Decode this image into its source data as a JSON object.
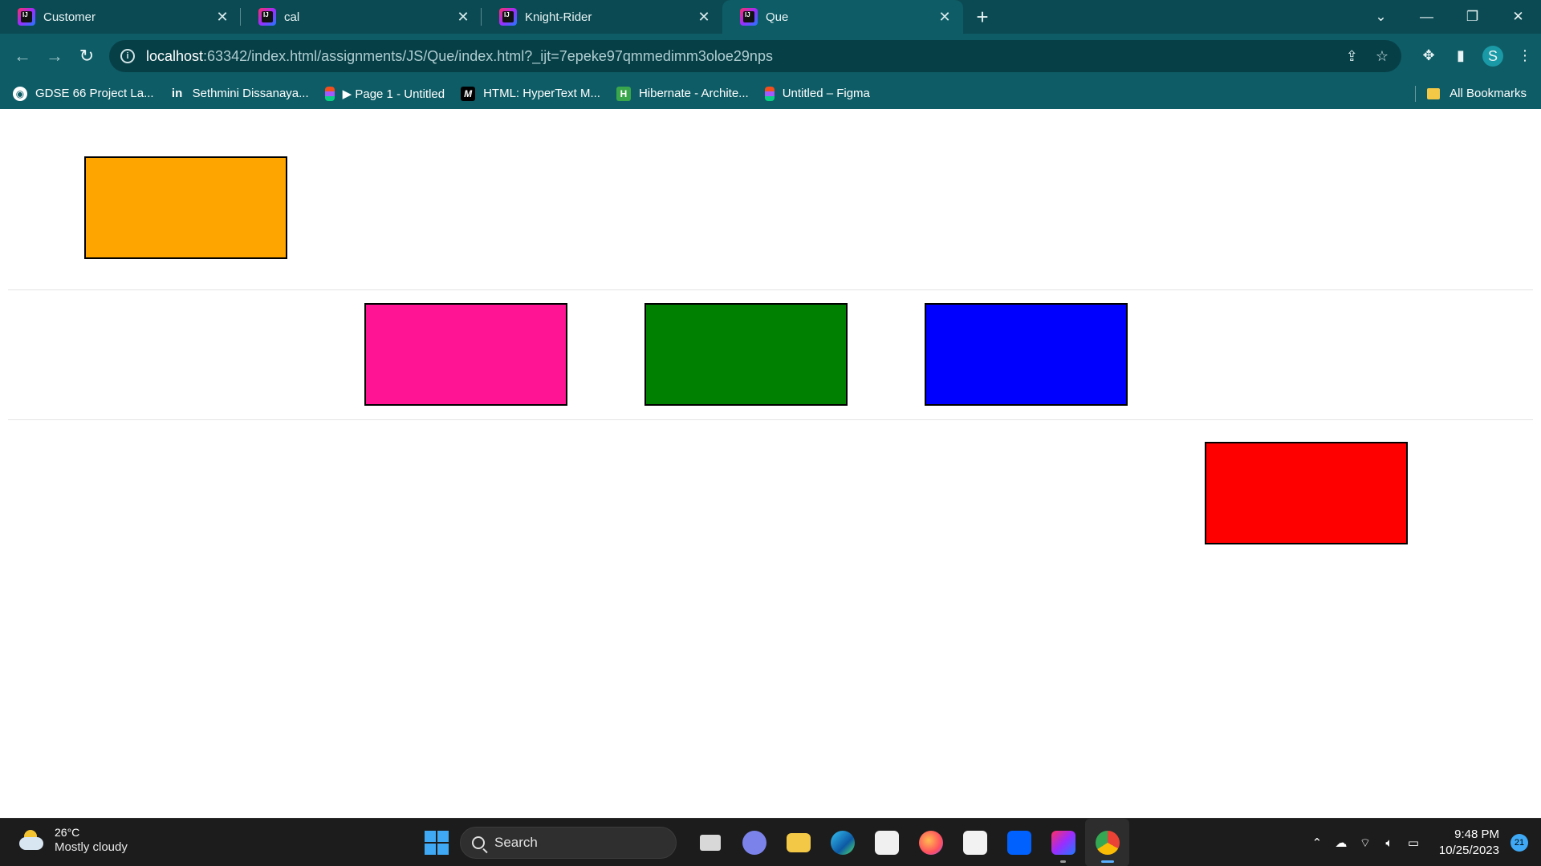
{
  "browser": {
    "tabs": [
      {
        "title": "Customer",
        "active": false
      },
      {
        "title": "cal",
        "active": false
      },
      {
        "title": "Knight-Rider",
        "active": false
      },
      {
        "title": "Que",
        "active": true
      }
    ],
    "close_glyph": "✕",
    "new_tab_glyph": "+",
    "url_host": "localhost",
    "url_rest": ":63342/index.html/assignments/JS/Que/index.html?_ijt=7epeke97qmmedimm3oloe29nps",
    "profile_initial": "S",
    "bookmarks": [
      {
        "label": "GDSE 66 Project La...",
        "icon": "github-icon"
      },
      {
        "label": "Sethmini Dissanaya...",
        "icon": "linkedin-icon"
      },
      {
        "label": "▶ Page 1 - Untitled",
        "icon": "figma-icon"
      },
      {
        "label": "HTML: HyperText M...",
        "icon": "mdn-icon"
      },
      {
        "label": "Hibernate - Archite...",
        "icon": "hibernate-icon"
      },
      {
        "label": "Untitled – Figma",
        "icon": "figma-icon"
      }
    ],
    "all_bookmarks_label": "All Bookmarks"
  },
  "page": {
    "boxes": [
      {
        "name": "orange-box",
        "color": "#ffa500"
      },
      {
        "name": "pink-box",
        "color": "#ff1493"
      },
      {
        "name": "green-box",
        "color": "#008000"
      },
      {
        "name": "blue-box",
        "color": "#0000ff"
      },
      {
        "name": "red-box",
        "color": "#ff0000"
      }
    ]
  },
  "taskbar": {
    "temperature": "26°C",
    "weather": "Mostly cloudy",
    "search_label": "Search",
    "time": "9:48 PM",
    "date": "10/25/2023",
    "notification_count": "21"
  }
}
